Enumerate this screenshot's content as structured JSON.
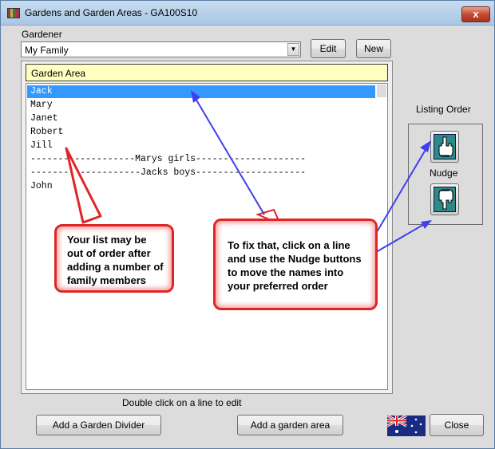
{
  "window": {
    "title": "Gardens and Garden Areas - GA100S10",
    "close_glyph": "x"
  },
  "gardener": {
    "label": "Gardener",
    "selected": "My Family",
    "edit_label": "Edit",
    "new_label": "New"
  },
  "list": {
    "header": "Garden Area",
    "rows": [
      "Jack",
      "Mary",
      "Janet",
      "Robert",
      "Jill",
      "-------------------Marys girls--------------------",
      "--------------------Jacks boys--------------------",
      "John"
    ],
    "selected_index": 0
  },
  "listing_order": {
    "label": "Listing Order",
    "nudge_label": "Nudge"
  },
  "callouts": {
    "left": "Your list may be out of order after adding a number of family members",
    "right": "To fix that, click on a line and use the Nudge buttons to move the names into your preferred order"
  },
  "footer": {
    "hint": "Double click on  a line to edit",
    "divider_button": "Add a Garden Divider",
    "area_button": "Add a garden area",
    "close_button": "Close"
  },
  "colors": {
    "selection": "#3399ff",
    "header_bg": "#ffffc0",
    "callout_border": "#e02525",
    "arrow": "#3f3ff0"
  },
  "icons": [
    "app-icon",
    "dropdown-arrow-icon",
    "hand-pointing-up-icon",
    "hand-pointing-down-icon",
    "australian-flag-icon"
  ]
}
